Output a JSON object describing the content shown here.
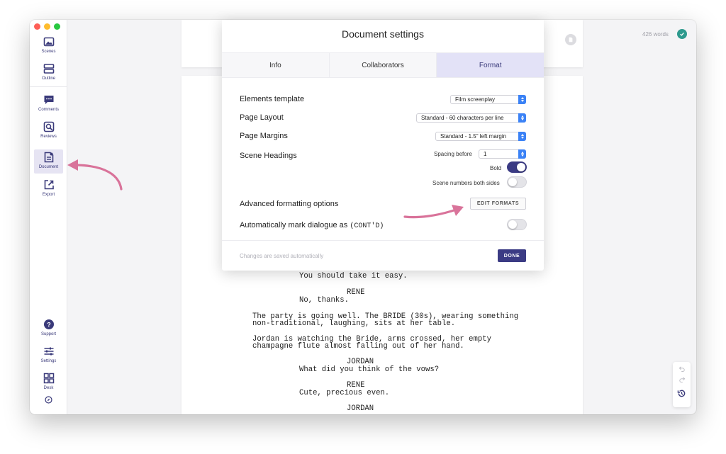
{
  "sidebar": {
    "items": [
      {
        "label": "Scenes"
      },
      {
        "label": "Outline"
      },
      {
        "label": "Comments"
      },
      {
        "label": "Reviews"
      },
      {
        "label": "Document"
      },
      {
        "label": "Export"
      },
      {
        "label": "Support"
      },
      {
        "label": "Settings"
      },
      {
        "label": "Desk"
      }
    ]
  },
  "header": {
    "word_count": "426 words"
  },
  "dialog": {
    "title": "Document settings",
    "tabs": [
      {
        "label": "Info"
      },
      {
        "label": "Collaborators"
      },
      {
        "label": "Format",
        "active": true
      }
    ],
    "elements_template": {
      "label": "Elements template",
      "value": "Film screenplay"
    },
    "page_layout": {
      "label": "Page Layout",
      "value": "Standard - 60 characters per line"
    },
    "page_margins": {
      "label": "Page Margins",
      "value": "Standard - 1.5\" left margin"
    },
    "scene_headings": {
      "label": "Scene Headings",
      "spacing_label": "Spacing before",
      "spacing_value": "1",
      "bold_label": "Bold",
      "bold_on": true,
      "numbers_label": "Scene numbers both sides",
      "numbers_on": false
    },
    "advanced": {
      "label": "Advanced formatting options",
      "button": "EDIT FORMATS"
    },
    "auto_contd": {
      "label": "Automatically mark dialogue as",
      "code": "(CONT'D)",
      "on": false
    },
    "footer": {
      "autosave": "Changes are saved automatically",
      "done": "DONE"
    }
  },
  "script": {
    "lines": [
      "You should take it easy.",
      "RENE",
      "No, thanks.",
      "The party is going well. The BRIDE (30s), wearing something",
      "non-traditional, laughing, sits at her table.",
      "Jordan is watching the Bride, arms crossed, her empty",
      "champagne flute almost falling out of her hand.",
      "JORDAN",
      "What did you think of the vows?",
      "RENE",
      "Cute, precious even.",
      "JORDAN"
    ]
  },
  "colors": {
    "accent": "#3b3b84",
    "tab_active": "#e3e2f7",
    "annotation": "#d9739a",
    "select_arrow": "#3b82f6",
    "check": "#2e9a8e"
  }
}
